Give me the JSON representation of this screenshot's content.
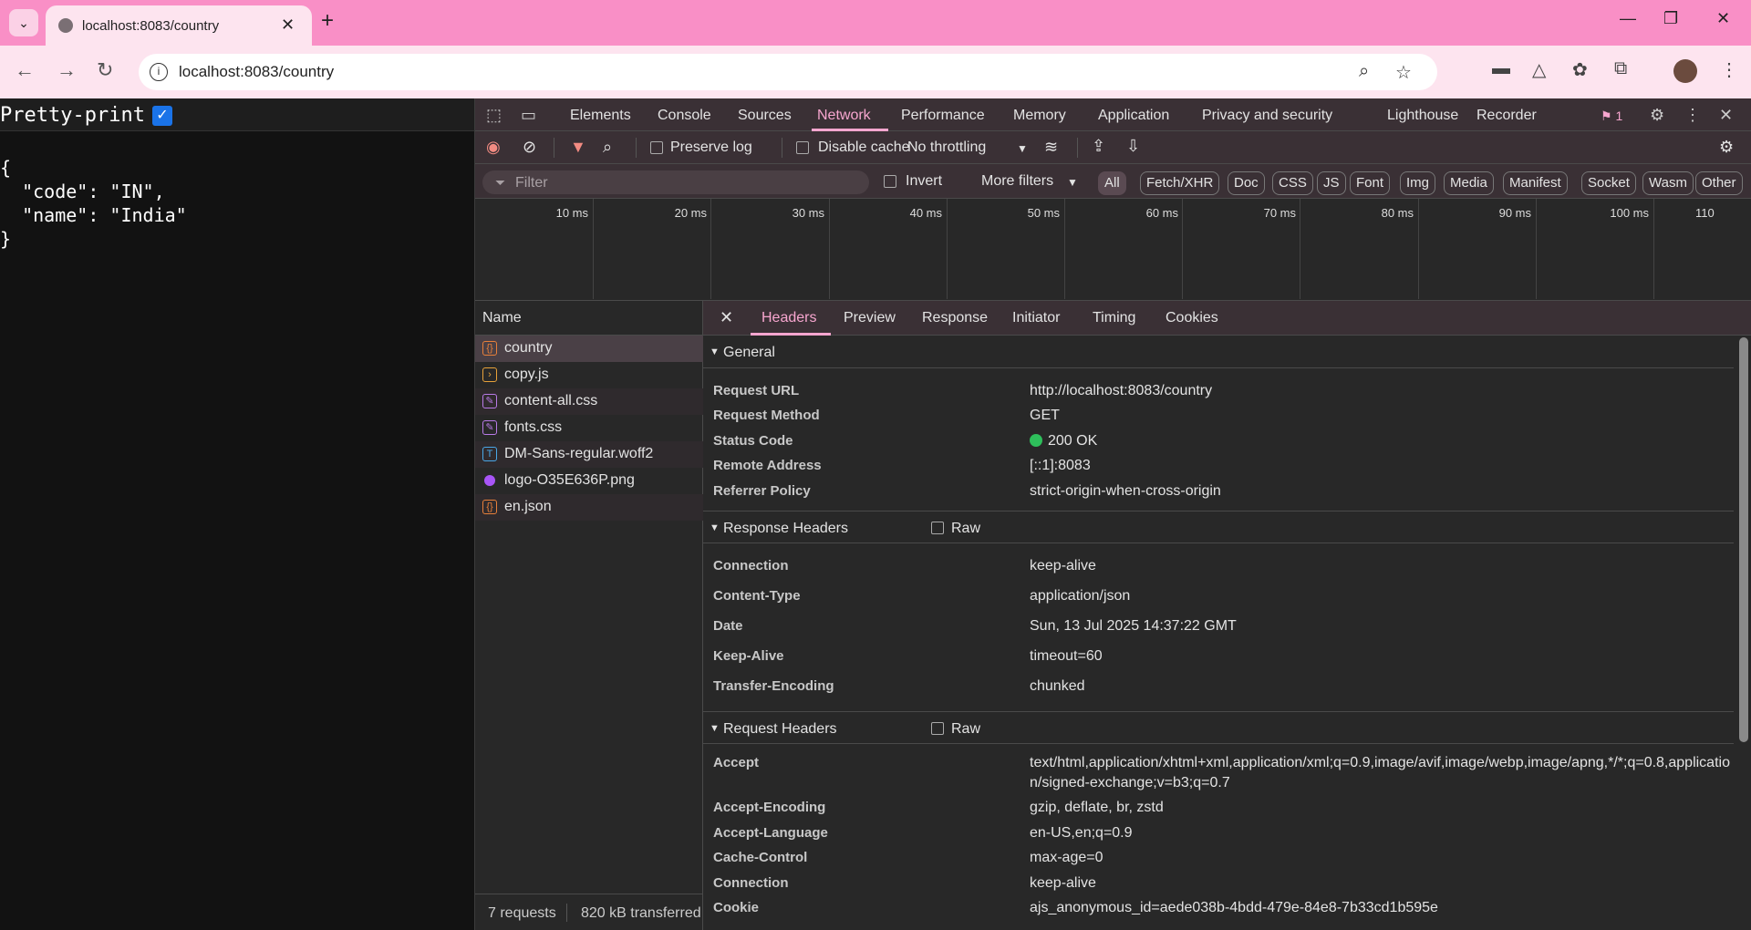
{
  "browser": {
    "tab_title": "localhost:8083/country",
    "url": "localhost:8083/country"
  },
  "page": {
    "pretty_print_label": "Pretty-print",
    "json_lines": [
      "{",
      "  \"code\": \"IN\",",
      "  \"name\": \"India\"",
      "}"
    ]
  },
  "devtools": {
    "tabs": [
      "Elements",
      "Console",
      "Sources",
      "Network",
      "Performance",
      "Memory",
      "Application",
      "Privacy and security",
      "Lighthouse",
      "Recorder"
    ],
    "active_tab": "Network",
    "issues_count": "1",
    "toolbar": {
      "preserve_log": "Preserve log",
      "disable_cache": "Disable cache",
      "throttling": "No throttling"
    },
    "filter": {
      "placeholder": "Filter",
      "invert": "Invert",
      "more_filters": "More filters",
      "chips": [
        "All",
        "Fetch/XHR",
        "Doc",
        "CSS",
        "JS",
        "Font",
        "Img",
        "Media",
        "Manifest",
        "Socket",
        "Wasm",
        "Other"
      ]
    },
    "timeline_labels": [
      "10 ms",
      "20 ms",
      "30 ms",
      "40 ms",
      "50 ms",
      "60 ms",
      "70 ms",
      "80 ms",
      "90 ms",
      "100 ms",
      "110"
    ],
    "requests": {
      "header": "Name",
      "items": [
        {
          "name": "country",
          "icon": "json-icon",
          "color": "#e8803a"
        },
        {
          "name": "copy.js",
          "icon": "script-icon",
          "color": "#e8a23a"
        },
        {
          "name": "content-all.css",
          "icon": "stylesheet-icon",
          "color": "#b97be8"
        },
        {
          "name": "fonts.css",
          "icon": "stylesheet-icon",
          "color": "#b97be8"
        },
        {
          "name": "DM-Sans-regular.woff2",
          "icon": "font-icon",
          "color": "#4aa8e8"
        },
        {
          "name": "logo-O35E636P.png",
          "icon": "image-icon",
          "color": "#a855f7"
        },
        {
          "name": "en.json",
          "icon": "json-icon",
          "color": "#e8803a"
        }
      ],
      "summary_count": "7 requests",
      "summary_transferred": "820 kB transferred"
    },
    "detail": {
      "tabs": [
        "Headers",
        "Preview",
        "Response",
        "Initiator",
        "Timing",
        "Cookies"
      ],
      "active_tab": "Headers",
      "general": {
        "title": "General",
        "rows": [
          {
            "key": "Request URL",
            "value": "http://localhost:8083/country"
          },
          {
            "key": "Request Method",
            "value": "GET"
          },
          {
            "key": "Status Code",
            "value": "200 OK"
          },
          {
            "key": "Remote Address",
            "value": "[::1]:8083"
          },
          {
            "key": "Referrer Policy",
            "value": "strict-origin-when-cross-origin"
          }
        ]
      },
      "response_headers": {
        "title": "Response Headers",
        "raw": "Raw",
        "rows": [
          {
            "key": "Connection",
            "value": "keep-alive"
          },
          {
            "key": "Content-Type",
            "value": "application/json"
          },
          {
            "key": "Date",
            "value": "Sun, 13 Jul 2025 14:37:22 GMT"
          },
          {
            "key": "Keep-Alive",
            "value": "timeout=60"
          },
          {
            "key": "Transfer-Encoding",
            "value": "chunked"
          }
        ]
      },
      "request_headers": {
        "title": "Request Headers",
        "raw": "Raw",
        "rows": [
          {
            "key": "Accept",
            "value": "text/html,application/xhtml+xml,application/xml;q=0.9,image/avif,image/webp,image/apng,*/*;q=0.8,application/signed-exchange;v=b3;q=0.7"
          },
          {
            "key": "Accept-Encoding",
            "value": "gzip, deflate, br, zstd"
          },
          {
            "key": "Accept-Language",
            "value": "en-US,en;q=0.9"
          },
          {
            "key": "Cache-Control",
            "value": "max-age=0"
          },
          {
            "key": "Connection",
            "value": "keep-alive"
          },
          {
            "key": "Cookie",
            "value": "ajs_anonymous_id=aede038b-4bdd-479e-84e8-7b33cd1b595e"
          }
        ]
      }
    }
  },
  "colors": {
    "browser_accent": "#f98fc6",
    "devtools_accent": "#f7a6cf",
    "status_ok": "#2ebf5b"
  }
}
